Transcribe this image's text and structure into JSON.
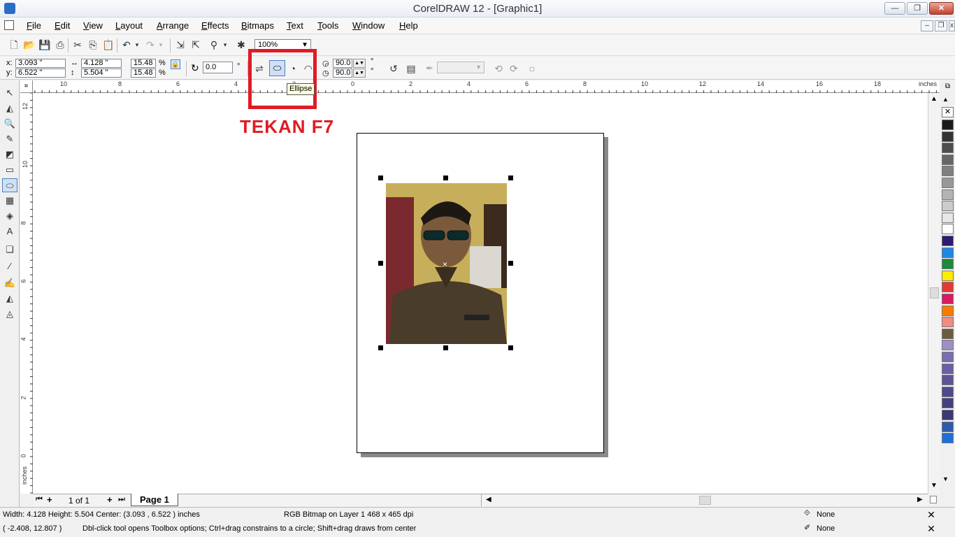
{
  "window": {
    "title": "CorelDRAW 12 - [Graphic1]"
  },
  "menu": [
    {
      "label": "File",
      "key": "F",
      "rest": "ile"
    },
    {
      "label": "Edit",
      "key": "E",
      "rest": "dit"
    },
    {
      "label": "View",
      "key": "V",
      "rest": "iew"
    },
    {
      "label": "Layout",
      "key": "L",
      "rest": "ayout"
    },
    {
      "label": "Arrange",
      "key": "A",
      "rest": "rrange"
    },
    {
      "label": "Effects",
      "key": "E",
      "rest": "ffects"
    },
    {
      "label": "Bitmaps",
      "key": "B",
      "rest": "itmaps"
    },
    {
      "label": "Text",
      "key": "T",
      "rest": "ext"
    },
    {
      "label": "Tools",
      "key": "T",
      "rest": "ools"
    },
    {
      "label": "Window",
      "key": "W",
      "rest": "indow"
    },
    {
      "label": "Help",
      "key": "H",
      "rest": "elp"
    }
  ],
  "toolbar": {
    "zoom": "100%"
  },
  "properties": {
    "x": "3.093 \"",
    "y": "6.522 \"",
    "x_label": "x:",
    "y_label": "y:",
    "width": "4.128 \"",
    "height": "5.504 \"",
    "scale_w": "15.48",
    "scale_h": "15.48",
    "pct": "%",
    "rotation": "0.0",
    "deg": "°",
    "start_angle": "90.0",
    "end_angle": "90.0"
  },
  "tooltip": "Ellipse",
  "annotation": "TEKAN F7",
  "ruler": {
    "h_labels": [
      "10",
      "8",
      "6",
      "4",
      "2",
      "0",
      "2",
      "4",
      "6",
      "8",
      "10",
      "12",
      "14",
      "16",
      "18"
    ],
    "v_labels": [
      "12",
      "10",
      "8",
      "6",
      "4",
      "2",
      "0"
    ],
    "unit": "inches"
  },
  "page_nav": {
    "count": "1 of 1",
    "tab": "Page 1"
  },
  "status": {
    "dims": "Width: 4.128  Height: 5.504  Center: (3.093 , 6.522 )  inches",
    "object": "RGB Bitmap on Layer 1 468 x 465 dpi",
    "cursor": "( -2.408, 12.807 )",
    "hint": "Dbl-click tool opens Toolbox options; Ctrl+drag constrains to a circle; Shift+drag draws from center",
    "fill": "None",
    "outline": "None"
  },
  "palette": [
    "#ffffff",
    "#1a1a1a",
    "#333333",
    "#4d4d4d",
    "#666666",
    "#808080",
    "#999999",
    "#b3b3b3",
    "#cccccc",
    "#e6e6e6",
    "#ffffff",
    "#2e1a6e",
    "#1e88e5",
    "#1b8a3a",
    "#ffeb00",
    "#e53935",
    "#d81b60",
    "#f57c00",
    "#f28b82",
    "#6d5b3e",
    "#9e8fc7",
    "#7a6fb0",
    "#6a5fa6",
    "#5c5499",
    "#4e4a8c",
    "#444080",
    "#3a3975",
    "#2f5aa8",
    "#1e6fd9"
  ]
}
